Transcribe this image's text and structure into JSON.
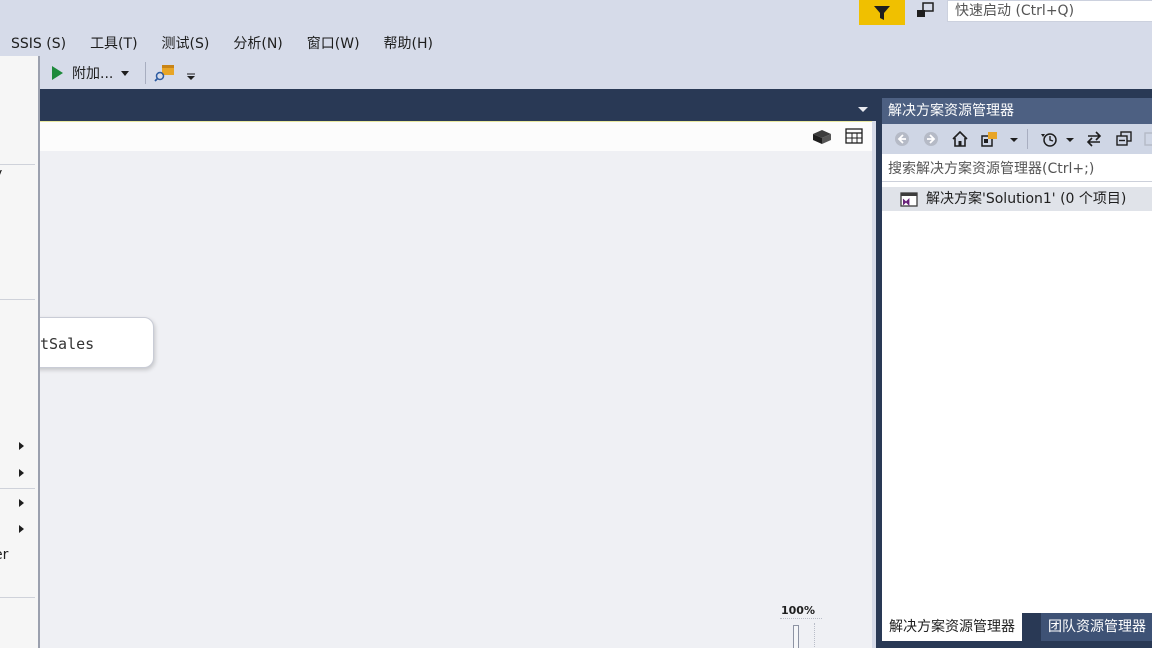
{
  "quick_launch": {
    "placeholder": "快速启动 (Ctrl+Q)"
  },
  "menu": [
    "SSIS (S)",
    "工具(T)",
    "测试(S)",
    "分析(N)",
    "窗口(W)",
    "帮助(H)"
  ],
  "toolbar": {
    "attach_label": "附加..."
  },
  "designer": {
    "task_label": "tSales",
    "zoom_label": "100%"
  },
  "flyout": {
    "texts": [
      "y",
      "er"
    ]
  },
  "solution_explorer": {
    "title": "解决方案资源管理器",
    "search_placeholder": "搜索解决方案资源管理器(Ctrl+;)",
    "node_label": "解决方案'Solution1' (0 个项目)",
    "tab_active": "解决方案资源管理器",
    "tab_inactive": "团队资源管理器"
  },
  "colors": {
    "accent_dark": "#293955",
    "panel_title": "#4d6082",
    "notification": "#f0c000",
    "run_green": "#1e8a3c"
  },
  "icons": [
    "filter-icon",
    "feedback-icon",
    "play-icon",
    "find-icon",
    "overflow-icon",
    "cube-icon",
    "table-icon",
    "back-icon",
    "forward-icon",
    "home-icon",
    "switch-views-icon",
    "history-icon",
    "sync-icon",
    "collapse-icon",
    "solution-icon"
  ]
}
